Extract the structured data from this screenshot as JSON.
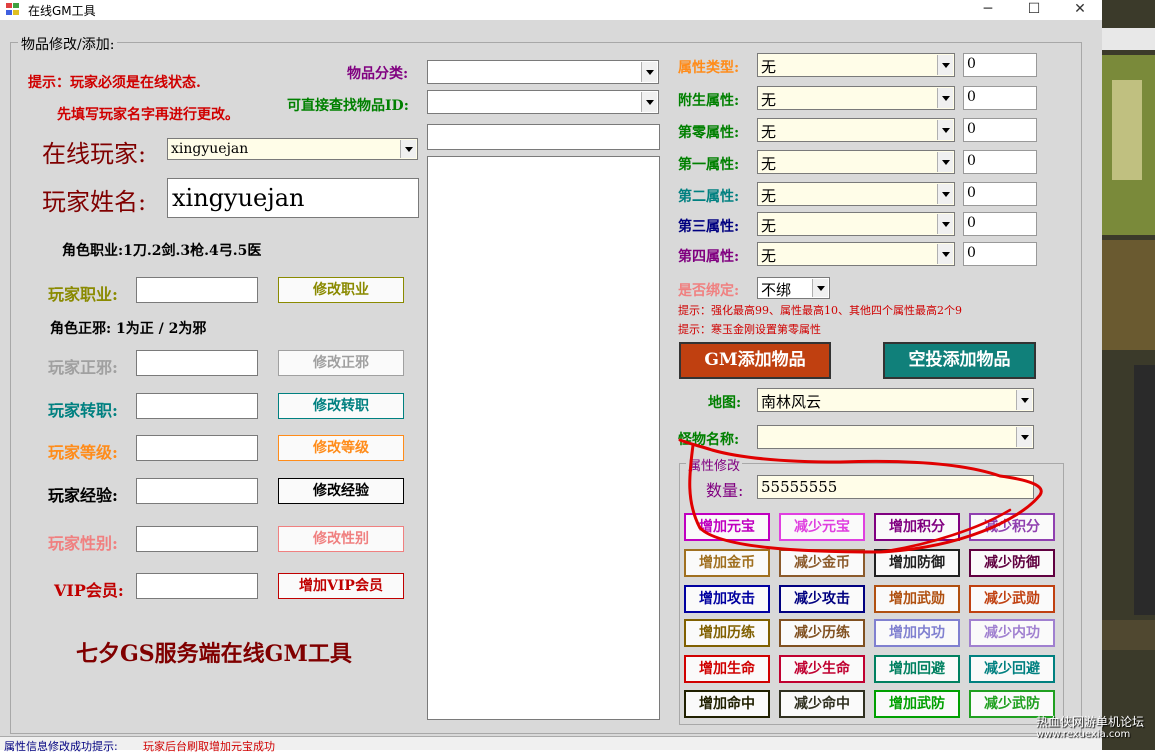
{
  "window": {
    "title": "在线GM工具",
    "minimize_glyph": "─",
    "maximize_glyph": "☐",
    "close_glyph": "✕"
  },
  "group_title": "物品修改/添加:",
  "left": {
    "tip1": "提示：玩家必须是在线状态.",
    "tip2": "先填写玩家名字再进行更改。",
    "online_player_label": "在线玩家:",
    "online_player_value": "xingyuejan",
    "player_name_label": "玩家姓名:",
    "player_name_value": "xingyuejan",
    "job_hint": "角色职业:1刀.2剑.3枪.4弓.5医",
    "alignment_hint": "角色正邪: 1为正 / 2为邪",
    "rows": [
      {
        "label": "玩家职业:",
        "button": "修改职业",
        "color": "#8a8a00"
      },
      {
        "label": "玩家正邪:",
        "button": "修改正邪",
        "color": "#a0a0a0"
      },
      {
        "label": "玩家转职:",
        "button": "修改转职",
        "color": "#008080"
      },
      {
        "label": "玩家等级:",
        "button": "修改等级",
        "color": "#ff8c1a"
      },
      {
        "label": "玩家经验:",
        "button": "修改经验",
        "color": "#000000"
      },
      {
        "label": "玩家性别:",
        "button": "修改性别",
        "color": "#f08080"
      },
      {
        "label": "VIP会员:",
        "button": "增加VIP会员",
        "color": "#c00000"
      }
    ],
    "footer": "七夕GS服务端在线GM工具"
  },
  "middle": {
    "category_label": "物品分类:",
    "find_id_label": "可直接查找物品ID:"
  },
  "right": {
    "attrs": [
      {
        "label": "属性类型:",
        "value": "无",
        "num": "0",
        "color": "#ff8c1a"
      },
      {
        "label": "附生属性:",
        "value": "无",
        "num": "0",
        "color": "#008000"
      },
      {
        "label": "第零属性:",
        "value": "无",
        "num": "0",
        "color": "#008000"
      },
      {
        "label": "第一属性:",
        "value": "无",
        "num": "0",
        "color": "#008000"
      },
      {
        "label": "第二属性:",
        "value": "无",
        "num": "0",
        "color": "#008080"
      },
      {
        "label": "第三属性:",
        "value": "无",
        "num": "0",
        "color": "#000080"
      },
      {
        "label": "第四属性:",
        "value": "无",
        "num": "0",
        "color": "#800080"
      }
    ],
    "bind_label": "是否绑定:",
    "bind_value": "不绑",
    "hint1": "提示：强化最高99、属性最高10、其他四个属性最高2个9",
    "hint2": "提示：寒玉金刚设置第零属性",
    "gm_add_button": "GM添加物品",
    "airdrop_add_button": "空投添加物品",
    "map_label": "地图:",
    "map_value": "南林风云",
    "monster_label": "怪物名称:",
    "monster_value": "",
    "attr_group_title": "属性修改",
    "quantity_label": "数量:",
    "quantity_value": "55555555",
    "buttons": [
      {
        "label": "增加元宝",
        "color": "#c000c0"
      },
      {
        "label": "减少元宝",
        "color": "#e040e0"
      },
      {
        "label": "增加积分",
        "color": "#800080"
      },
      {
        "label": "减少积分",
        "color": "#9040b0"
      },
      {
        "label": "增加金币",
        "color": "#a07020"
      },
      {
        "label": "减少金币",
        "color": "#8b5a2b"
      },
      {
        "label": "增加防御",
        "color": "#202020"
      },
      {
        "label": "减少防御",
        "color": "#600040"
      },
      {
        "label": "增加攻击",
        "color": "#0000a0"
      },
      {
        "label": "减少攻击",
        "color": "#000080"
      },
      {
        "label": "增加武勋",
        "color": "#b05010"
      },
      {
        "label": "减少武勋",
        "color": "#c04010"
      },
      {
        "label": "增加历练",
        "color": "#806000"
      },
      {
        "label": "减少历练",
        "color": "#805020"
      },
      {
        "label": "增加内功",
        "color": "#8080d0"
      },
      {
        "label": "减少内功",
        "color": "#a080d0"
      },
      {
        "label": "增加生命",
        "color": "#d00000"
      },
      {
        "label": "减少生命",
        "color": "#c00030"
      },
      {
        "label": "增加回避",
        "color": "#008060"
      },
      {
        "label": "减少回避",
        "color": "#008080"
      },
      {
        "label": "增加命中",
        "color": "#202000"
      },
      {
        "label": "减少命中",
        "color": "#303020"
      },
      {
        "label": "增加武防",
        "color": "#00a000"
      },
      {
        "label": "减少武防",
        "color": "#20a020"
      }
    ]
  },
  "status": {
    "label": "属性信息修改成功提示:",
    "message": "玩家后台刷取增加元宝成功"
  },
  "watermark": {
    "line1": "热血侠网游单机论坛",
    "line2": "www.rexuexia.com"
  },
  "colors": {
    "tip_red": "#d00000",
    "gm_button_bg": "#c04010",
    "airdrop_button_bg": "#10807a",
    "input_yellow": "#fffde8",
    "annotation_red": "#e00000"
  }
}
